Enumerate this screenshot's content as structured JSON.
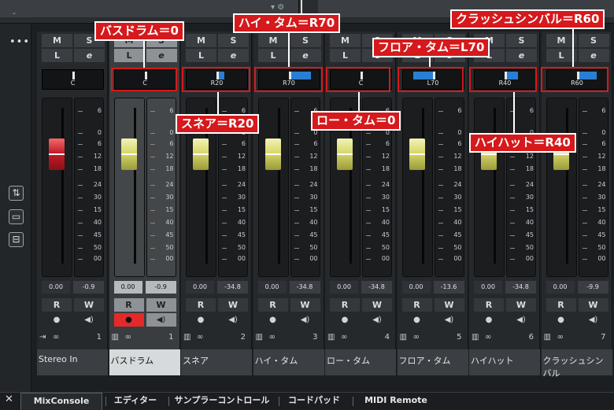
{
  "topbar": {
    "dash": "-"
  },
  "channels": [
    {
      "name": "Stereo In",
      "pan": "C",
      "vol": "0.00",
      "peak": "-0.9",
      "num": "1",
      "cap": "red",
      "fader_pos": 0.2,
      "pan_dir": "c"
    },
    {
      "name": "バスドラム",
      "pan": "C",
      "vol": "0.00",
      "peak": "-0.9",
      "num": "1",
      "cap": "yel",
      "fader_pos": 0.2,
      "pan_dir": "c"
    },
    {
      "name": "スネア",
      "pan": "R20",
      "vol": "0.00",
      "peak": "-34.8",
      "num": "2",
      "cap": "yel",
      "fader_pos": 0.2,
      "pan_dir": "r",
      "pan_amount": 0.2
    },
    {
      "name": "ハイ・タム",
      "pan": "R70",
      "vol": "0.00",
      "peak": "-34.8",
      "num": "3",
      "cap": "yel",
      "fader_pos": 0.2,
      "pan_dir": "r",
      "pan_amount": 0.7
    },
    {
      "name": "ロー・タム",
      "pan": "C",
      "vol": "0.00",
      "peak": "-34.8",
      "num": "4",
      "cap": "yel",
      "fader_pos": 0.2,
      "pan_dir": "c"
    },
    {
      "name": "フロア・タム",
      "pan": "L70",
      "vol": "0.00",
      "peak": "-13.6",
      "num": "5",
      "cap": "yel",
      "fader_pos": 0.2,
      "pan_dir": "l",
      "pan_amount": 0.7
    },
    {
      "name": "ハイハット",
      "pan": "R40",
      "vol": "0.00",
      "peak": "-34.8",
      "num": "6",
      "cap": "yel",
      "fader_pos": 0.2,
      "pan_dir": "r",
      "pan_amount": 0.4
    },
    {
      "name": "クラッシュシンバル",
      "pan": "R60",
      "vol": "0.00",
      "peak": "-9.9",
      "num": "7",
      "cap": "yel",
      "fader_pos": 0.2,
      "pan_dir": "r",
      "pan_amount": 0.6
    }
  ],
  "labels": {
    "mute": "M",
    "solo": "S",
    "listen": "L",
    "edit": "e",
    "read": "R",
    "write": "W"
  },
  "scale": [
    "6",
    "0",
    "6",
    "12",
    "18",
    "24",
    "30",
    "15",
    "40",
    "45",
    "50",
    "00"
  ],
  "tabs": [
    "MixConsole",
    "エディター",
    "サンプラーコントロール",
    "コードパッド",
    "MIDI Remote"
  ],
  "annotations": {
    "kick": "バスドラム＝0",
    "hitom": "ハイ・タム＝R70",
    "crash": "クラッシュシンバル＝R60",
    "floortom": "フロア・タム＝L70",
    "snare": "スネア＝R20",
    "lowtom": "ロー・タム＝0",
    "hihat": "ハイハット＝R40"
  },
  "colors": {
    "annotation": "#d5191c",
    "pan_bar": "#2a7fd4",
    "fader_red": "#c51d2a",
    "fader_yellow": "#d8d86a",
    "record": "#e42929"
  }
}
